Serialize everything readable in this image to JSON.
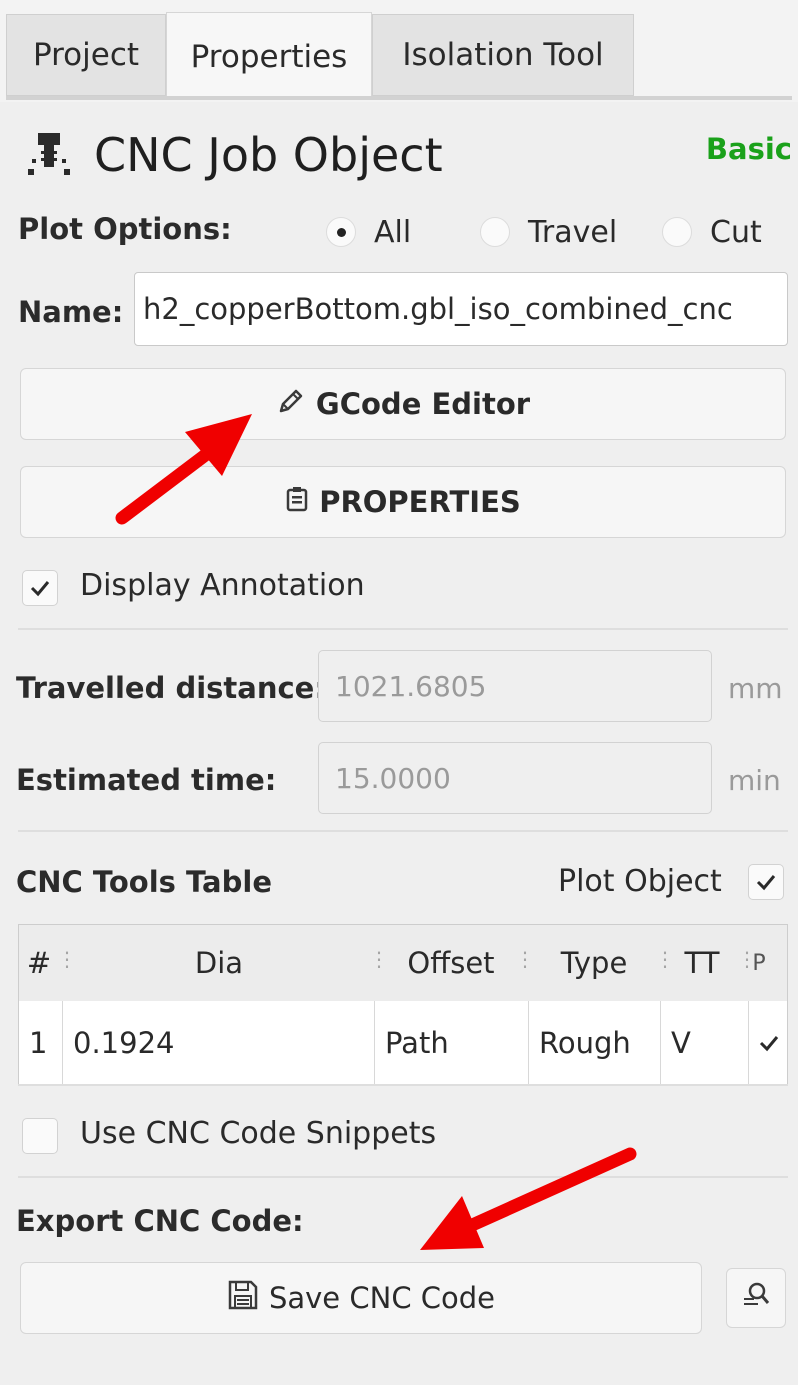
{
  "tabs": [
    {
      "label": "Project",
      "active": false
    },
    {
      "label": "Properties",
      "active": true
    },
    {
      "label": "Isolation Tool",
      "active": false
    }
  ],
  "header": {
    "title": "CNC Job Object",
    "mode": "Basic",
    "icon": "cnc-drill-icon"
  },
  "plot_options": {
    "label": "Plot Options:",
    "options": [
      {
        "label": "All",
        "checked": true
      },
      {
        "label": "Travel",
        "checked": false
      },
      {
        "label": "Cut",
        "checked": false
      }
    ]
  },
  "name": {
    "label": "Name:",
    "value": "h2_copperBottom.gbl_iso_combined_cnc"
  },
  "buttons": {
    "gcode_editor": "GCode Editor",
    "properties": "PROPERTIES",
    "save_cnc": "Save CNC Code"
  },
  "display_annotation": {
    "label": "Display Annotation",
    "checked": true
  },
  "travelled": {
    "label": "Travelled distance:",
    "value": "1021.6805",
    "unit": "mm"
  },
  "estimated": {
    "label": "Estimated time:",
    "value": "15.0000",
    "unit": "min"
  },
  "tools_table": {
    "title": "CNC Tools Table",
    "plot_object_label": "Plot Object",
    "plot_object_checked": true,
    "headers": [
      "#",
      "Dia",
      "Offset",
      "Type",
      "TT",
      "P"
    ],
    "rows": [
      {
        "num": "1",
        "dia": "0.1924",
        "offset": "Path",
        "type": "Rough",
        "tt": "V",
        "plot": true
      }
    ]
  },
  "snippets": {
    "label": "Use CNC Code Snippets",
    "checked": false
  },
  "export": {
    "label": "Export CNC Code:"
  },
  "colors": {
    "accent_green": "#1aa11a",
    "annotation_arrow": "#f00000"
  }
}
